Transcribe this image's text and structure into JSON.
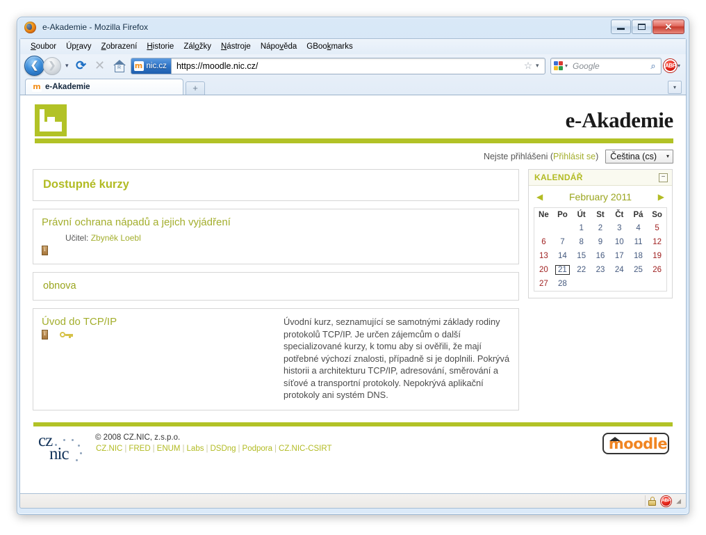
{
  "browser": {
    "window_title": "e-Akademie - Mozilla Firefox",
    "menus": [
      "Soubor",
      "Úpravy",
      "Zobrazení",
      "Historie",
      "Záložky",
      "Nástroje",
      "Nápověda",
      "GBookmarks"
    ],
    "url": "https://moodle.nic.cz/",
    "identity_label": "nic.cz",
    "search_placeholder": "Google",
    "tab_title": "e-Akademie",
    "newtab_label": "+",
    "reload_glyph": "⟳",
    "stop_glyph": "✕",
    "home_glyph": "R",
    "star_glyph": "☆",
    "magnifier_glyph": "⌕",
    "dropdown_glyph": "▾",
    "abp_label": "ABP",
    "minimize_label": "–",
    "maximize_label": "□",
    "close_label": "✕"
  },
  "site": {
    "name": "e-Akademie",
    "login_text": "Nejste přihlášeni (",
    "login_link": "Přihlásit se",
    "login_text_end": ")",
    "language_selected": "Čeština (cs)"
  },
  "main": {
    "category_heading": "Dostupné kurzy",
    "category_plain": "obnova",
    "courses": [
      {
        "name": "Právní ochrana nápadů a jejich vyjádření",
        "teacher_label": "Učitel:",
        "teacher_name": "Zbyněk Loebl",
        "summary": "",
        "has_info_icon": true,
        "has_key_icon": false
      },
      {
        "name": "Úvod do TCP/IP",
        "teacher_label": "",
        "teacher_name": "",
        "summary": "Úvodní kurz, seznamující se samotnými základy rodiny protokolů TCP/IP. Je určen zájemcům o další specializované kurzy, k tomu aby si ověřili, že mají potřebné výchozí znalosti, případně si je doplnili. Pokrývá historii a architekturu TCP/IP, adresování, směrování a síťové a transportní protokoly. Nepokrývá aplikační protokoly ani systém DNS.",
        "has_info_icon": true,
        "has_key_icon": true
      }
    ]
  },
  "calendar": {
    "block_title": "KALENDÁŘ",
    "minimize_label": "−",
    "prev_arrow": "◀",
    "next_arrow": "▶",
    "month_label": "February 2011",
    "weekday_headers": [
      "Ne",
      "Po",
      "Út",
      "St",
      "Čt",
      "Pá",
      "So"
    ],
    "weeks": [
      [
        "",
        "",
        "1",
        "2",
        "3",
        "4",
        "5"
      ],
      [
        "6",
        "7",
        "8",
        "9",
        "10",
        "11",
        "12"
      ],
      [
        "13",
        "14",
        "15",
        "16",
        "17",
        "18",
        "19"
      ],
      [
        "20",
        "21",
        "22",
        "23",
        "24",
        "25",
        "26"
      ],
      [
        "27",
        "28",
        "",
        "",
        "",
        "",
        ""
      ]
    ],
    "today": "21",
    "weekend_columns": [
      0,
      6
    ]
  },
  "footer": {
    "copyright": "© 2008 CZ.NIC, z.s.p.o.",
    "links": [
      "CZ.NIC",
      "FRED",
      "ENUM",
      "Labs",
      "DSDng",
      "Podpora",
      "CZ.NIC-CSIRT"
    ],
    "separator": "|",
    "logo_cz": "cz",
    "logo_nic": "nic",
    "moodle_label": "moodle"
  },
  "colors": {
    "accent_green": "#b2c226",
    "link_olive": "#a3ae2c",
    "heading_olive": "#b2bb23",
    "moodle_orange": "#f08522",
    "weekend_red": "#a02222",
    "calendar_day": "#44597e"
  }
}
